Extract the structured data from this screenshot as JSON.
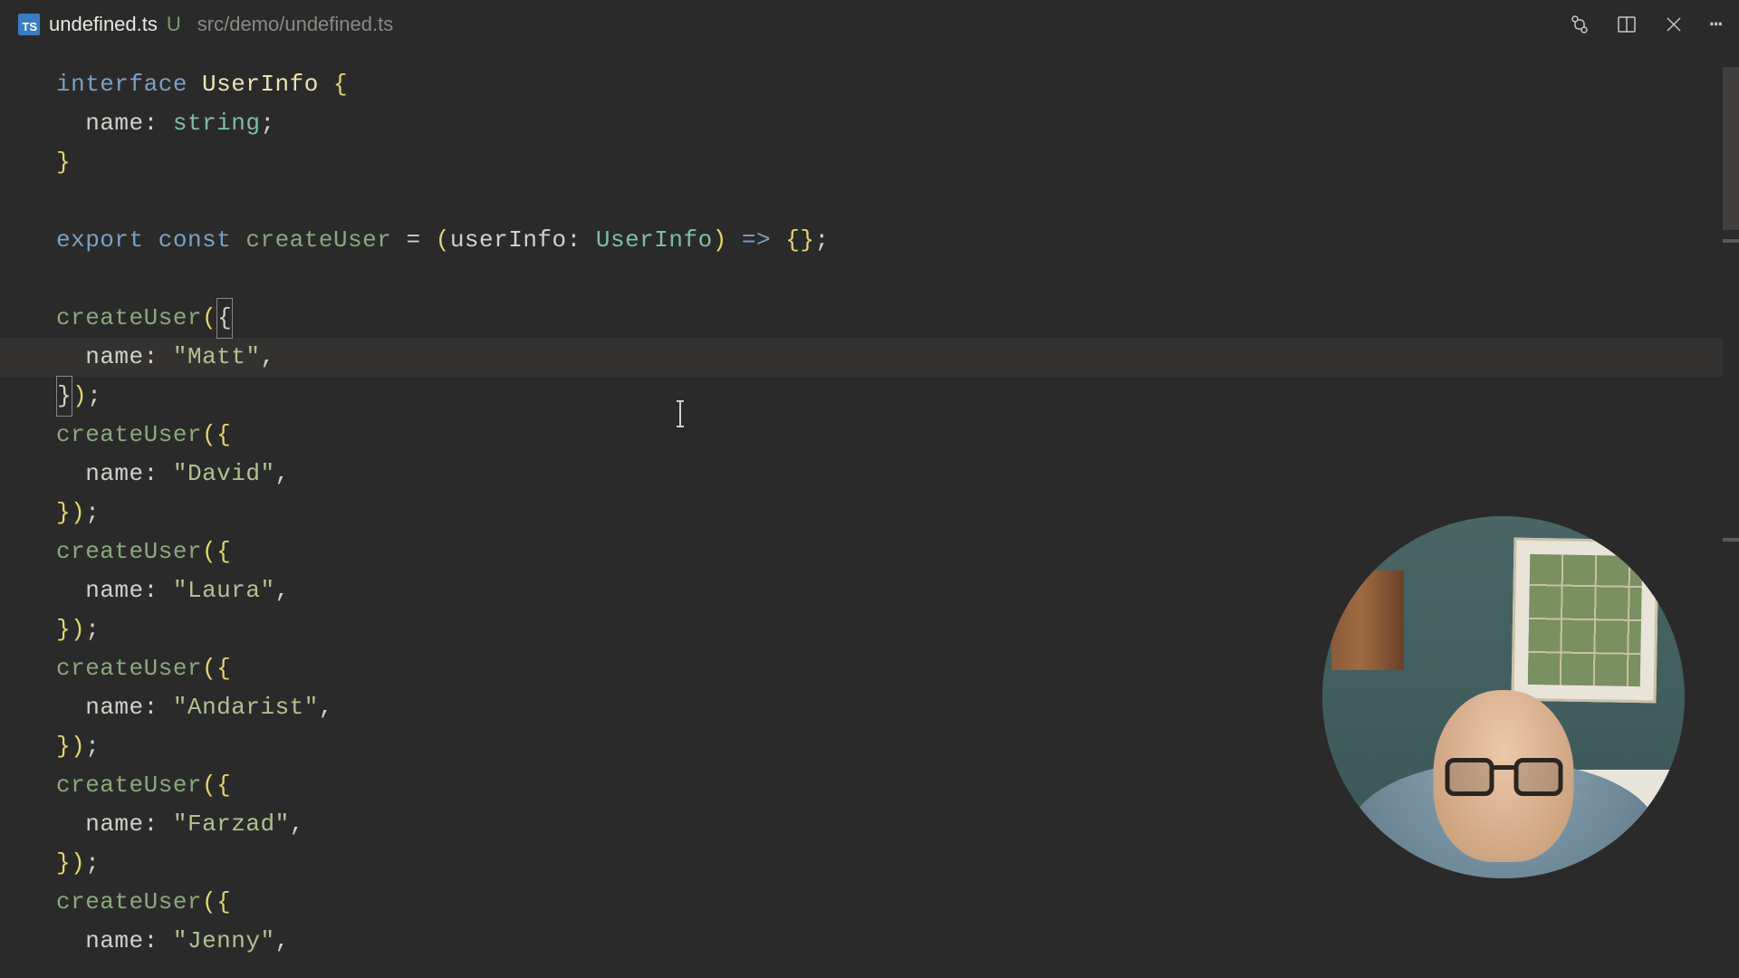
{
  "tab": {
    "name": "undefined.ts",
    "modified_indicator": "U",
    "lang_badge": "TS"
  },
  "breadcrumb": "src/demo/undefined.ts",
  "code": {
    "interface_name": "UserInfo",
    "prop_name": "name",
    "prop_type": "string",
    "fn_name": "createUser",
    "param_name": "userInfo",
    "param_type": "UserInfo",
    "kw_interface": "interface",
    "kw_export": "export",
    "kw_const": "const",
    "arrow": "=>",
    "calls": [
      {
        "name": "\"Matt\""
      },
      {
        "name": "\"David\""
      },
      {
        "name": "\"Laura\""
      },
      {
        "name": "\"Andarist\""
      },
      {
        "name": "\"Farzad\""
      },
      {
        "name": "\"Jenny\""
      }
    ]
  },
  "toolbar": {
    "compare_icon": "compare-changes-icon",
    "split_icon": "split-editor-icon",
    "close_icon": "close-icon",
    "more_icon": "more-icon"
  }
}
